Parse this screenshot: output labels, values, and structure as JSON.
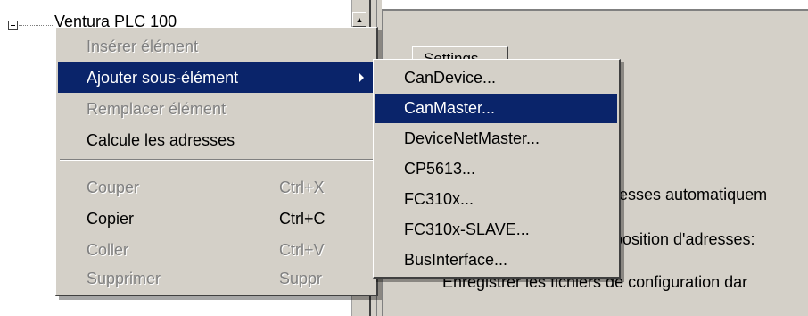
{
  "tree": {
    "node_label": "Ventura PLC 100",
    "scroll_up": "▲"
  },
  "right_pane": {
    "tab_label": "Settings",
    "line1": "dresses automatiquem",
    "line2": "position d'adresses:",
    "line3": "Enregistrer les fichiers de configuration dar"
  },
  "context_menu": {
    "items": [
      {
        "label": "Insérer élément",
        "disabled": true
      },
      {
        "label": "Ajouter sous-élément",
        "selected": true
      },
      {
        "label": "Remplacer élément",
        "disabled": true
      },
      {
        "label": "Calcule les adresses"
      },
      {
        "label": "Couper",
        "shortcut": "Ctrl+X",
        "disabled": true
      },
      {
        "label": "Copier",
        "shortcut": "Ctrl+C"
      },
      {
        "label": "Coller",
        "shortcut": "Ctrl+V",
        "disabled": true
      },
      {
        "label": "Supprimer",
        "shortcut": "Suppr",
        "disabled": true
      }
    ]
  },
  "submenu": {
    "items": [
      {
        "label": "CanDevice..."
      },
      {
        "label": "CanMaster...",
        "selected": true
      },
      {
        "label": "DeviceNetMaster..."
      },
      {
        "label": "CP5613..."
      },
      {
        "label": "FC310x..."
      },
      {
        "label": "FC310x-SLAVE..."
      },
      {
        "label": "BusInterface..."
      }
    ]
  },
  "colors": {
    "highlight": "#0a246a",
    "menu_bg": "#d4d0c8",
    "disabled_text": "#808080"
  }
}
